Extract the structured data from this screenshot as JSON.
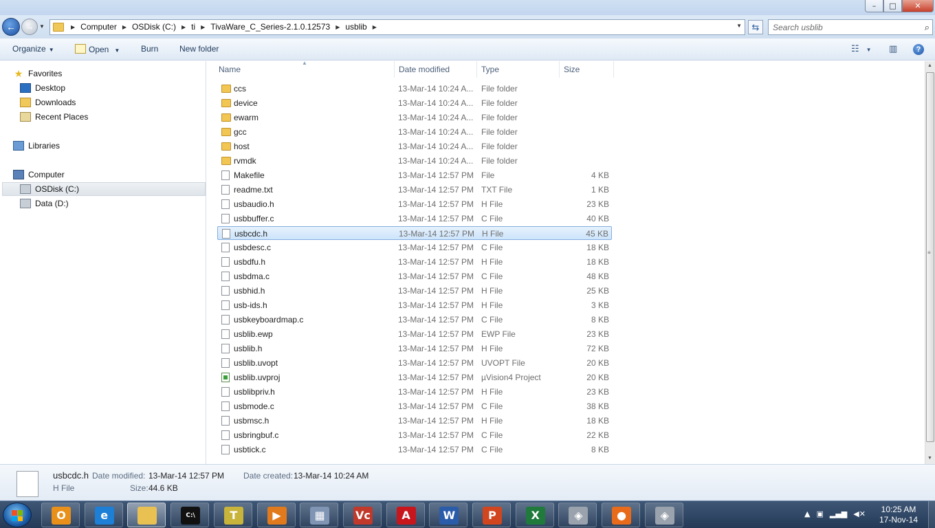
{
  "titlebar": {
    "title": ""
  },
  "window_controls": {
    "minimize": "–",
    "maximize": "□",
    "close": "✕"
  },
  "address": {
    "crumbs": [
      "Computer",
      "OSDisk (C:)",
      "ti",
      "TivaWare_C_Series-2.1.0.12573",
      "usblib"
    ]
  },
  "search": {
    "placeholder": "Search usblib"
  },
  "toolbar": {
    "organize": "Organize",
    "open": "Open",
    "burn": "Burn",
    "new_folder": "New folder"
  },
  "nav": {
    "favorites": "Favorites",
    "desktop": "Desktop",
    "downloads": "Downloads",
    "recent_places": "Recent Places",
    "libraries": "Libraries",
    "computer": "Computer",
    "osdisk": "OSDisk (C:)",
    "data": "Data (D:)"
  },
  "columns": {
    "name": "Name",
    "date": "Date modified",
    "type": "Type",
    "size": "Size"
  },
  "files": [
    {
      "name": "ccs",
      "date": "13-Mar-14 10:24 A...",
      "type": "File folder",
      "size": "",
      "icon": "folder"
    },
    {
      "name": "device",
      "date": "13-Mar-14 10:24 A...",
      "type": "File folder",
      "size": "",
      "icon": "folder"
    },
    {
      "name": "ewarm",
      "date": "13-Mar-14 10:24 A...",
      "type": "File folder",
      "size": "",
      "icon": "folder"
    },
    {
      "name": "gcc",
      "date": "13-Mar-14 10:24 A...",
      "type": "File folder",
      "size": "",
      "icon": "folder"
    },
    {
      "name": "host",
      "date": "13-Mar-14 10:24 A...",
      "type": "File folder",
      "size": "",
      "icon": "folder"
    },
    {
      "name": "rvmdk",
      "date": "13-Mar-14 10:24 A...",
      "type": "File folder",
      "size": "",
      "icon": "folder"
    },
    {
      "name": "Makefile",
      "date": "13-Mar-14 12:57 PM",
      "type": "File",
      "size": "4 KB",
      "icon": "file"
    },
    {
      "name": "readme.txt",
      "date": "13-Mar-14 12:57 PM",
      "type": "TXT File",
      "size": "1 KB",
      "icon": "file"
    },
    {
      "name": "usbaudio.h",
      "date": "13-Mar-14 12:57 PM",
      "type": "H File",
      "size": "23 KB",
      "icon": "file"
    },
    {
      "name": "usbbuffer.c",
      "date": "13-Mar-14 12:57 PM",
      "type": "C File",
      "size": "40 KB",
      "icon": "file"
    },
    {
      "name": "usbcdc.h",
      "date": "13-Mar-14 12:57 PM",
      "type": "H File",
      "size": "45 KB",
      "icon": "file",
      "selected": true
    },
    {
      "name": "usbdesc.c",
      "date": "13-Mar-14 12:57 PM",
      "type": "C File",
      "size": "18 KB",
      "icon": "file"
    },
    {
      "name": "usbdfu.h",
      "date": "13-Mar-14 12:57 PM",
      "type": "H File",
      "size": "18 KB",
      "icon": "file"
    },
    {
      "name": "usbdma.c",
      "date": "13-Mar-14 12:57 PM",
      "type": "C File",
      "size": "48 KB",
      "icon": "file"
    },
    {
      "name": "usbhid.h",
      "date": "13-Mar-14 12:57 PM",
      "type": "H File",
      "size": "25 KB",
      "icon": "file"
    },
    {
      "name": "usb-ids.h",
      "date": "13-Mar-14 12:57 PM",
      "type": "H File",
      "size": "3 KB",
      "icon": "file"
    },
    {
      "name": "usbkeyboardmap.c",
      "date": "13-Mar-14 12:57 PM",
      "type": "C File",
      "size": "8 KB",
      "icon": "file"
    },
    {
      "name": "usblib.ewp",
      "date": "13-Mar-14 12:57 PM",
      "type": "EWP File",
      "size": "23 KB",
      "icon": "file"
    },
    {
      "name": "usblib.h",
      "date": "13-Mar-14 12:57 PM",
      "type": "H File",
      "size": "72 KB",
      "icon": "file"
    },
    {
      "name": "usblib.uvopt",
      "date": "13-Mar-14 12:57 PM",
      "type": "UVOPT File",
      "size": "20 KB",
      "icon": "file"
    },
    {
      "name": "usblib.uvproj",
      "date": "13-Mar-14 12:57 PM",
      "type": "µVision4 Project",
      "size": "20 KB",
      "icon": "proj"
    },
    {
      "name": "usblibpriv.h",
      "date": "13-Mar-14 12:57 PM",
      "type": "H File",
      "size": "23 KB",
      "icon": "file"
    },
    {
      "name": "usbmode.c",
      "date": "13-Mar-14 12:57 PM",
      "type": "C File",
      "size": "38 KB",
      "icon": "file"
    },
    {
      "name": "usbmsc.h",
      "date": "13-Mar-14 12:57 PM",
      "type": "H File",
      "size": "18 KB",
      "icon": "file"
    },
    {
      "name": "usbringbuf.c",
      "date": "13-Mar-14 12:57 PM",
      "type": "C File",
      "size": "22 KB",
      "icon": "file"
    },
    {
      "name": "usbtick.c",
      "date": "13-Mar-14 12:57 PM",
      "type": "C File",
      "size": "8 KB",
      "icon": "file"
    }
  ],
  "details": {
    "name": "usbcdc.h",
    "type": "H File",
    "modified_label": "Date modified:",
    "modified": "13-Mar-14 12:57 PM",
    "created_label": "Date created:",
    "created": "13-Mar-14 10:24 AM",
    "size_label": "Size:",
    "size": "44.6 KB"
  },
  "taskbar": {
    "apps": [
      {
        "name": "outlook",
        "glyph": "O",
        "color": "#e8901a"
      },
      {
        "name": "internet-explorer",
        "glyph": "e",
        "color": "#1d7fd6"
      },
      {
        "name": "explorer",
        "glyph": "",
        "color": "#e9c152",
        "active": true
      },
      {
        "name": "command-prompt",
        "glyph": "C:\\",
        "color": "#111111"
      },
      {
        "name": "notepad-app",
        "glyph": "T",
        "color": "#c9b43b"
      },
      {
        "name": "media-player",
        "glyph": "▶",
        "color": "#e07a1c"
      },
      {
        "name": "calculator",
        "glyph": "▦",
        "color": "#7f95b3"
      },
      {
        "name": "visio-app",
        "glyph": "Vc",
        "color": "#c0392b"
      },
      {
        "name": "acrobat",
        "glyph": "A",
        "color": "#c8161d"
      },
      {
        "name": "word",
        "glyph": "W",
        "color": "#2a5caa"
      },
      {
        "name": "powerpoint",
        "glyph": "P",
        "color": "#d2461f"
      },
      {
        "name": "excel",
        "glyph": "X",
        "color": "#1f7a3c"
      },
      {
        "name": "virtual-box-1",
        "glyph": "◈",
        "color": "#9aa3ad"
      },
      {
        "name": "firefox",
        "glyph": "●",
        "color": "#e86b1b"
      },
      {
        "name": "virtual-box-2",
        "glyph": "◈",
        "color": "#9aa3ad"
      }
    ],
    "time": "10:25 AM",
    "date": "17-Nov-14"
  }
}
